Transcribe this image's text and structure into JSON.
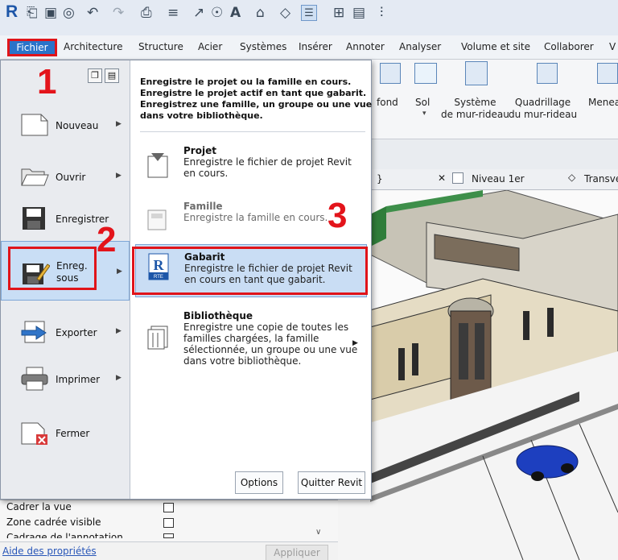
{
  "qat": {
    "icons": [
      "revit-logo",
      "open-icon",
      "save-icon",
      "sync-icon",
      "undo-icon",
      "redo-icon",
      "print-icon",
      "measure-icon",
      "dimension-icon",
      "tag-icon",
      "text-icon",
      "3d-view-icon",
      "section-icon",
      "thin-lines-icon",
      "close-hidden-icon",
      "switch-windows-icon",
      "customize-icon"
    ],
    "logo": "R"
  },
  "tabs": [
    "Fichier",
    "Architecture",
    "Structure",
    "Acier",
    "Systèmes",
    "Insérer",
    "Annoter",
    "Analyser",
    "Volume et site",
    "Collaborer",
    "V"
  ],
  "ribbon": {
    "items": [
      "fond",
      "Sol",
      "Système\nde mur-rideau",
      "Quadrillage\ndu mur-rideau",
      "Menea"
    ]
  },
  "viewtabs": {
    "close": "✕",
    "niveau": "Niveau 1er",
    "transv": "Transve",
    "brace": "}"
  },
  "menu": {
    "left": [
      {
        "label": "Nouveau",
        "arrow": true
      },
      {
        "label": "Ouvrir",
        "arrow": true
      },
      {
        "label": "Enregistrer",
        "arrow": false
      },
      {
        "label": "Enreg.\nsous",
        "arrow": true
      },
      {
        "label": "Exporter",
        "arrow": true
      },
      {
        "label": "Imprimer",
        "arrow": true
      },
      {
        "label": "Fermer",
        "arrow": false
      }
    ],
    "header": "Enregistre le projet ou la famille en cours.\nEnregistre le projet actif en tant que gabarit.\nEnregistrez une famille, un groupe ou une vue\ndans votre bibliothèque.",
    "items": [
      {
        "title": "Projet",
        "desc": "Enregistre le fichier de projet Revit en cours."
      },
      {
        "title": "Famille",
        "desc": "Enregistre la famille en cours."
      },
      {
        "title": "Gabarit",
        "desc": "Enregistre le fichier de projet Revit en cours en tant que gabarit."
      },
      {
        "title": "Bibliothèque",
        "desc": "Enregistre une copie de toutes les familles chargées, la famille sélectionnée, un groupe ou une vue dans votre bibliothèque."
      }
    ],
    "options_label": "Options",
    "quit_label": "Quitter Revit"
  },
  "props": {
    "rows": [
      "Cadrer la vue",
      "Zone cadrée visible",
      "Cadrage de l'annotation"
    ],
    "help_link": "Aide des propriétés",
    "apply": "Appliquer"
  },
  "annotations": [
    "1",
    "2",
    "3"
  ],
  "colors": {
    "accent": "#2a73c9",
    "highlight": "#c9ddf4",
    "annotation": "#e0141a"
  }
}
